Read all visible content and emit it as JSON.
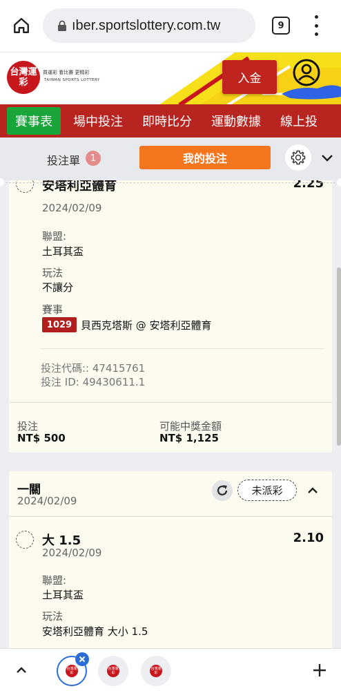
{
  "browser": {
    "url": "ıber.sportslottery.com.tw",
    "tab_count": "9"
  },
  "header": {
    "logo_text": "台灣運彩",
    "slogan": "買運彩 看比賽 更精彩",
    "logo_en": "TAIWAN SPORTS LOTTERY",
    "deposit_label": "入金"
  },
  "nav": {
    "items": [
      {
        "label": "賽事表"
      },
      {
        "label": "場中投注"
      },
      {
        "label": "即時比分"
      },
      {
        "label": "運動數據"
      },
      {
        "label": "線上投"
      }
    ]
  },
  "slip": {
    "label": "投注單",
    "count": "1",
    "my_bets_label": "我的投注"
  },
  "bet1": {
    "selection": "安塔利亞體育",
    "odds": "2.25",
    "date": "2024/02/09",
    "league_label": "聯盟:",
    "league": "土耳其盃",
    "market_label": "玩法",
    "market": "不讓分",
    "event_label": "賽事",
    "event_code": "1029",
    "event_name": "貝西克塔斯 @ 安塔利亞體育",
    "bet_code": "投注代碼:: 47415761",
    "bet_id": "投注 ID: 49430611.1",
    "stake_label": "投注",
    "stake": "NT$ 500",
    "payout_label": "可能中獎金額",
    "payout": "NT$ 1,125"
  },
  "bet2": {
    "title": "一關",
    "date": "2024/02/09",
    "status": "未派彩",
    "selection": "大 1.5",
    "odds": "2.10",
    "sel_date": "2024/02/09",
    "league_label": "聯盟:",
    "league": "土耳其盃",
    "market_label": "玩法",
    "market": "安塔利亞體育 大小 1.5"
  },
  "tabs": {
    "mini_logo": "台灣運彩"
  },
  "colors": {
    "brand_red": "#c8161d",
    "nav_red": "#b82520",
    "active_green": "#1aa53a",
    "orange": "#f4761f"
  }
}
